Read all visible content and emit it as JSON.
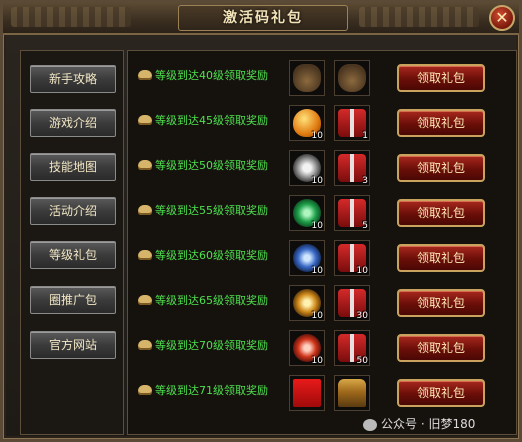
{
  "window": {
    "title": "激活码礼包",
    "close_label": "✕"
  },
  "sidebar": {
    "items": [
      {
        "label": "新手攻略"
      },
      {
        "label": "游戏介绍"
      },
      {
        "label": "技能地图"
      },
      {
        "label": "活动介绍"
      },
      {
        "label": "等级礼包"
      },
      {
        "label": "圈推广包"
      },
      {
        "label": "官方网站"
      }
    ]
  },
  "rewards": [
    {
      "text": "等级到达40级领取奖励",
      "item1": {
        "icon": "money-bag-icon",
        "count": ""
      },
      "item2": {
        "icon": "money-bag-icon",
        "count": ""
      },
      "button": "领取礼包"
    },
    {
      "text": "等级到达45级领取奖励",
      "item1": {
        "icon": "golden-egg-icon",
        "count": "10"
      },
      "item2": {
        "icon": "gift-box-icon",
        "count": "1"
      },
      "button": "领取礼包"
    },
    {
      "text": "等级到达50级领取奖励",
      "item1": {
        "icon": "silver-orb-icon",
        "count": "10"
      },
      "item2": {
        "icon": "gift-box-icon",
        "count": "3"
      },
      "button": "领取礼包"
    },
    {
      "text": "等级到达55级领取奖励",
      "item1": {
        "icon": "jade-orb-icon",
        "count": "10"
      },
      "item2": {
        "icon": "gift-box-icon",
        "count": "5"
      },
      "button": "领取礼包"
    },
    {
      "text": "等级到达60级领取奖励",
      "item1": {
        "icon": "blue-orb-icon",
        "count": "10"
      },
      "item2": {
        "icon": "gift-box-icon",
        "count": "10"
      },
      "button": "领取礼包"
    },
    {
      "text": "等级到达65级领取奖励",
      "item1": {
        "icon": "gold-orb-icon",
        "count": "10"
      },
      "item2": {
        "icon": "gift-box-icon",
        "count": "30"
      },
      "button": "领取礼包"
    },
    {
      "text": "等级到达70级领取奖励",
      "item1": {
        "icon": "red-orb-icon",
        "count": "10"
      },
      "item2": {
        "icon": "gift-box-icon",
        "count": "50"
      },
      "button": "领取礼包"
    },
    {
      "text": "等级到达71级领取奖励",
      "item1": {
        "icon": "red-envelope-icon",
        "count": ""
      },
      "item2": {
        "icon": "treasure-chest-icon",
        "count": ""
      },
      "button": "领取礼包"
    }
  ],
  "watermark": {
    "text": "公众号 · 旧梦180"
  }
}
